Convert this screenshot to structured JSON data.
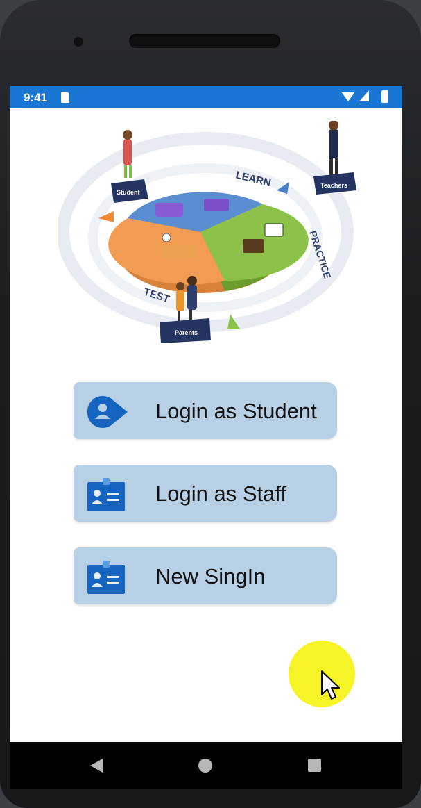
{
  "status_bar": {
    "time": "9:41",
    "icons": [
      "sd-card-icon",
      "wifi-icon",
      "signal-icon",
      "battery-icon"
    ],
    "background": "#1976d2"
  },
  "illustration": {
    "labels": {
      "learn": "LEARN",
      "practice": "PRACTICE",
      "test": "TEST",
      "student": "Student",
      "teachers": "Teachers",
      "parents": "Parents"
    }
  },
  "buttons": {
    "student": {
      "label": "Login as Student",
      "icon": "student-avatar-icon"
    },
    "staff": {
      "label": "Login as Staff",
      "icon": "id-card-icon"
    },
    "signin": {
      "label": "New SingIn",
      "icon": "id-card-icon"
    }
  },
  "colors": {
    "button_bg": "#b7d0e6",
    "icon_blue": "#1565c0",
    "highlight": "#f6f21a"
  },
  "nav_bar": {
    "icons": [
      "back-icon",
      "home-icon",
      "recent-apps-icon"
    ]
  }
}
